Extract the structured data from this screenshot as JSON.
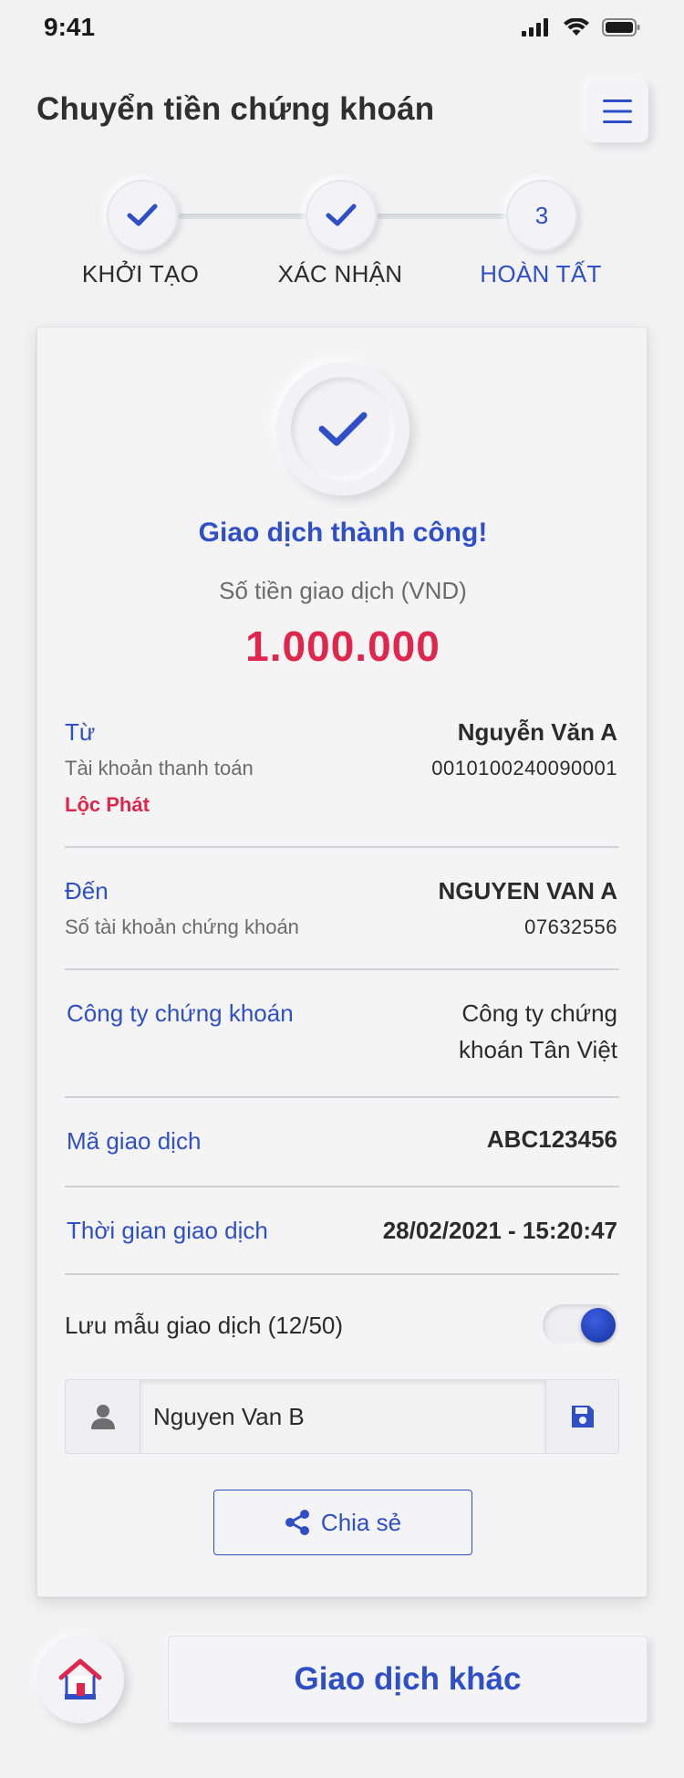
{
  "status_bar": {
    "time": "9:41"
  },
  "header": {
    "title": "Chuyển tiền chứng khoán"
  },
  "stepper": {
    "steps": [
      {
        "label": "KHỞI TẠO",
        "state": "done"
      },
      {
        "label": "XÁC NHẬN",
        "state": "done"
      },
      {
        "label": "HOÀN TẤT",
        "number": "3",
        "state": "active"
      }
    ]
  },
  "result": {
    "title": "Giao dịch thành công!",
    "amount_label": "Số tiền giao dịch (VND)",
    "amount": "1.000.000"
  },
  "from": {
    "label": "Từ",
    "name": "Nguyễn Văn A",
    "account_label": "Tài khoản thanh toán",
    "account_number": "0010100240090001",
    "bank": "Lộc Phát"
  },
  "to": {
    "label": "Đến",
    "name": "NGUYEN VAN A",
    "account_label": "Số tài khoản chứng khoán",
    "account_number": "07632556"
  },
  "company": {
    "label": "Công ty chứng khoán",
    "value_line1": "Công ty chứng",
    "value_line2": "khoán Tân Việt"
  },
  "transaction_code": {
    "label": "Mã giao dịch",
    "value": "ABC123456"
  },
  "transaction_time": {
    "label": "Thời gian giao dịch",
    "value": "28/02/2021 - 15:20:47"
  },
  "save_template": {
    "label": "Lưu mẫu giao dịch (12/50)",
    "enabled": true,
    "name_value": "Nguyen Van B"
  },
  "actions": {
    "share_label": "Chia sẻ",
    "other_label": "Giao dịch khác"
  },
  "colors": {
    "accent": "#2f4fc9",
    "amount": "#e0264d",
    "background": "#f2f2f3"
  }
}
